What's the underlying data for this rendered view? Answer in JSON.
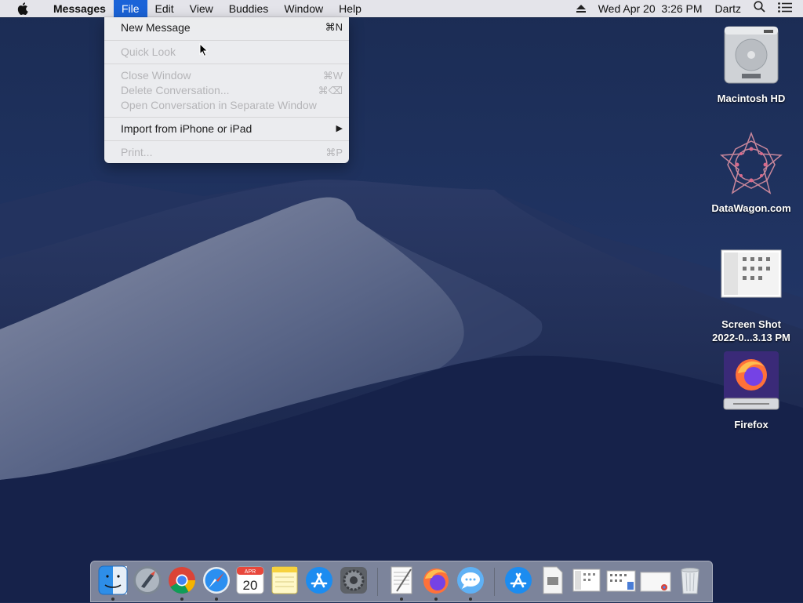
{
  "menubar": {
    "apple_icon": "apple-logo-icon",
    "app_name": "Messages",
    "menus": [
      "File",
      "Edit",
      "View",
      "Buddies",
      "Window",
      "Help"
    ],
    "active_menu": "File",
    "status": {
      "eject_icon": "eject-icon",
      "date": "Wed Apr 20",
      "time": "3:26 PM",
      "user": "Dartz",
      "search_icon": "spotlight-search-icon",
      "notifications_icon": "notification-center-icon"
    }
  },
  "file_menu": {
    "new_message": {
      "label": "New Message",
      "shortcut": "⌘N",
      "enabled": true
    },
    "quick_look": {
      "label": "Quick Look",
      "enabled": false
    },
    "close_window": {
      "label": "Close Window",
      "shortcut": "⌘W",
      "enabled": false
    },
    "delete_conversation": {
      "label": "Delete Conversation...",
      "shortcut": "⌘⌫",
      "enabled": false
    },
    "open_separate": {
      "label": "Open Conversation in Separate Window",
      "enabled": false
    },
    "import": {
      "label": "Import from iPhone or iPad",
      "submenu_arrow": "▶",
      "enabled": true
    },
    "print": {
      "label": "Print...",
      "shortcut": "⌘P",
      "enabled": false
    }
  },
  "desktop_icons": {
    "hd": "Macintosh HD",
    "datawagon": "DataWagon.com",
    "screenshot_line1": "Screen Shot",
    "screenshot_line2": "2022-0...3.13 PM",
    "firefox": "Firefox"
  },
  "dock": {
    "apps": [
      {
        "name": "Finder",
        "icon": "finder-icon",
        "running": true
      },
      {
        "name": "Launchpad",
        "icon": "launchpad-icon",
        "running": false
      },
      {
        "name": "Google Chrome",
        "icon": "chrome-icon",
        "running": true
      },
      {
        "name": "Safari",
        "icon": "safari-icon",
        "running": true
      },
      {
        "name": "Calendar",
        "icon": "calendar-icon",
        "running": false,
        "month": "APR",
        "day": "20"
      },
      {
        "name": "Notes",
        "icon": "notes-icon",
        "running": false
      },
      {
        "name": "App Store",
        "icon": "app-store-icon",
        "running": false
      },
      {
        "name": "System Preferences",
        "icon": "system-preferences-icon",
        "running": false
      },
      {
        "name": "TextEdit",
        "icon": "textedit-icon",
        "running": true
      },
      {
        "name": "Firefox",
        "icon": "firefox-icon",
        "running": true
      },
      {
        "name": "Messages",
        "icon": "messages-icon",
        "running": true
      },
      {
        "name": "Applications",
        "icon": "applications-folder-icon",
        "running": false
      },
      {
        "name": "Document",
        "icon": "document-icon",
        "running": false
      },
      {
        "name": "Screenshot",
        "icon": "screenshot-thumbnail-icon",
        "running": false
      },
      {
        "name": "Screenshot 2",
        "icon": "screenshot-thumbnail-icon",
        "running": false
      },
      {
        "name": "Chrome window",
        "icon": "chrome-window-icon",
        "running": false
      },
      {
        "name": "Trash",
        "icon": "trash-icon",
        "running": false
      }
    ]
  },
  "colors": {
    "menu_highlight": "#1a63d8",
    "wallpaper_dark": "#142247",
    "wallpaper_dune": "#6e7894"
  }
}
